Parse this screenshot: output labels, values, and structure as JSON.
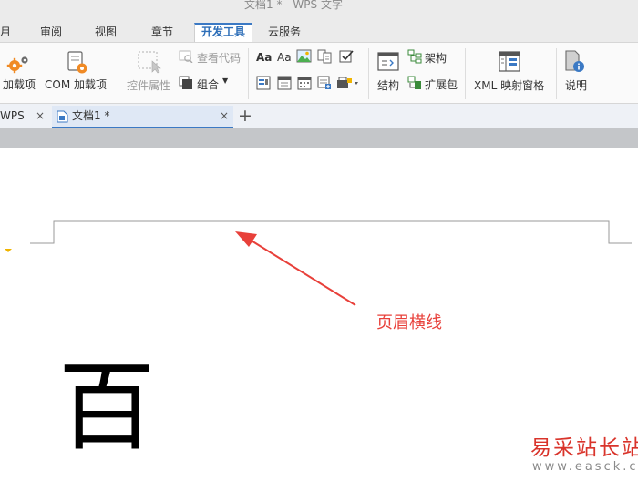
{
  "window": {
    "title": "文档1 * - WPS 文字"
  },
  "menu": {
    "tabs": [
      {
        "label": "月",
        "active": false
      },
      {
        "label": "审阅",
        "active": false
      },
      {
        "label": "视图",
        "active": false
      },
      {
        "label": "章节",
        "active": false
      },
      {
        "label": "开发工具",
        "active": true
      },
      {
        "label": "云服务",
        "active": false
      }
    ]
  },
  "ribbon": {
    "addins_label": "加载项",
    "com_addins_label": "COM 加载项",
    "control_properties_label": "控件属性",
    "view_code_label": "查看代码",
    "group_label": "组合",
    "structure_label": "结构",
    "schema_label": "架构",
    "expansion_pack_label": "扩展包",
    "xml_mapping_label": "XML 映射窗格",
    "help_label": "说明",
    "text_control_rich": "Aa",
    "text_control_plain": "Aa"
  },
  "doc_tabs": {
    "tabs": [
      {
        "label": "WPS",
        "active": false
      },
      {
        "label": "文档1 *",
        "active": true
      }
    ],
    "close_glyph": "×",
    "new_tab_glyph": "+"
  },
  "annotation": {
    "text": "页眉横线"
  },
  "document": {
    "body_char": "百"
  },
  "watermark": {
    "site_name": "易采站长站",
    "url": "www.easck.com"
  },
  "colors": {
    "accent": "#3b79c4",
    "annotation": "#e8403a",
    "watermark": "#d9342b"
  },
  "icons": [
    "gear-orange-icon",
    "com-addin-icon",
    "control-properties-icon",
    "view-code-icon",
    "group-icon",
    "image-control-icon",
    "checkbox-control-icon",
    "structure-icon",
    "schema-icon",
    "expansion-pack-icon",
    "xml-mapping-icon",
    "help-info-icon",
    "document-tab-icon"
  ]
}
